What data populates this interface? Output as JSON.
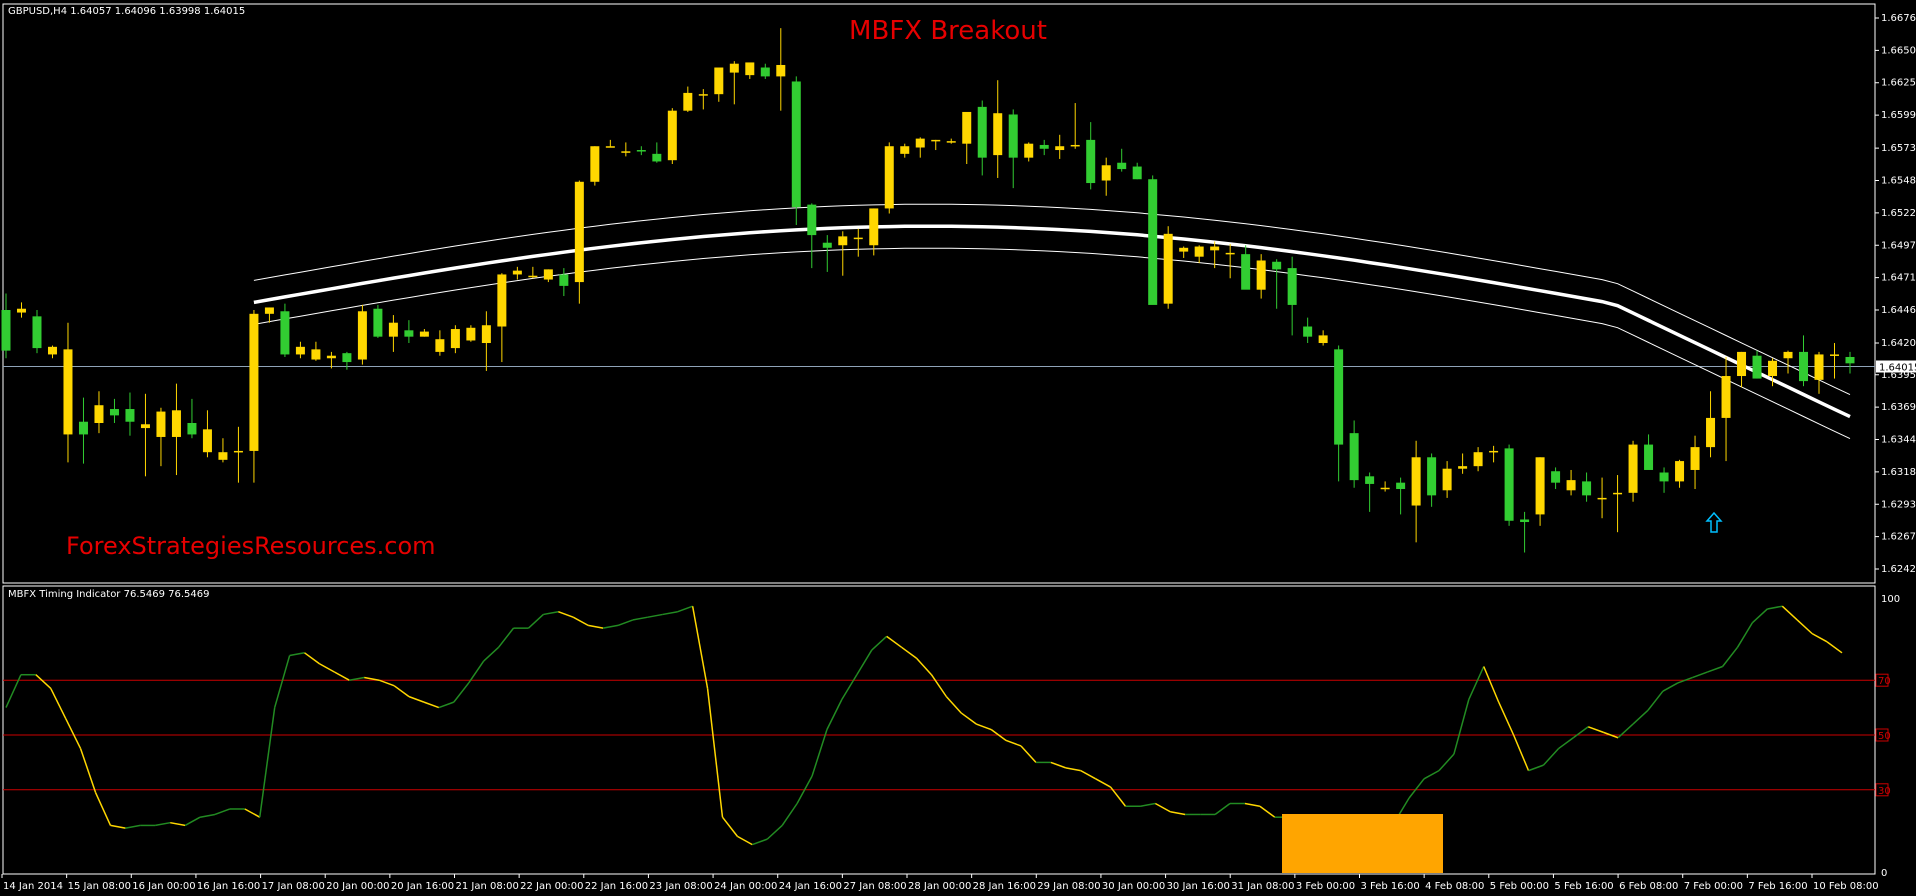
{
  "chart": {
    "header": "GBPUSD,H4  1.64057 1.64096 1.63998 1.64015",
    "title": "MBFX Breakout",
    "watermark": "ForexStrategiesResources.com",
    "indicator_header": "MBFX Timing Indicator 76.5469 76.5469",
    "current_price_label": "1.64015",
    "colors": {
      "background": "#000000",
      "bull_candle": "#32cd32",
      "bear_candle": "#ffd700",
      "envelope": "#ffffff",
      "indicator_up": "#228b22",
      "indicator_down": "#ffd700",
      "level_lines": "#cc0000",
      "signal_box": "#ffa500",
      "arrow": "#00bfff",
      "title": "#e60000",
      "watermark": "#e60000"
    }
  },
  "chart_data": [
    {
      "type": "candlestick",
      "symbol": "GBPUSD",
      "timeframe": "H4",
      "y_ticks": [
        "1.66760",
        "1.66505",
        "1.66250",
        "1.65995",
        "1.65735",
        "1.65480",
        "1.65225",
        "1.64970",
        "1.64715",
        "1.64460",
        "1.64200",
        "1.63950",
        "1.63695",
        "1.63440",
        "1.63185",
        "1.62930",
        "1.62675",
        "1.62420"
      ],
      "ylim": [
        1.6242,
        1.6676
      ],
      "x_ticks": [
        "14 Jan 2014",
        "15 Jan 08:00",
        "16 Jan 00:00",
        "16 Jan 16:00",
        "17 Jan 08:00",
        "20 Jan 00:00",
        "20 Jan 16:00",
        "21 Jan 08:00",
        "22 Jan 00:00",
        "22 Jan 16:00",
        "23 Jan 08:00",
        "24 Jan 00:00",
        "24 Jan 16:00",
        "27 Jan 08:00",
        "28 Jan 00:00",
        "28 Jan 16:00",
        "29 Jan 08:00",
        "30 Jan 00:00",
        "30 Jan 16:00",
        "31 Jan 08:00",
        "3 Feb 00:00",
        "3 Feb 16:00",
        "4 Feb 08:00",
        "5 Feb 00:00",
        "5 Feb 16:00",
        "6 Feb 08:00",
        "7 Feb 00:00",
        "7 Feb 16:00",
        "10 Feb 08:00"
      ],
      "current_price": 1.64015,
      "ohlc": [
        [
          1.6446,
          1.6459,
          1.6408,
          1.6414
        ],
        [
          1.6444,
          1.6452,
          1.644,
          1.6447
        ],
        [
          1.6441,
          1.6446,
          1.6412,
          1.6416
        ],
        [
          1.6411,
          1.6418,
          1.6408,
          1.6417
        ],
        [
          1.6348,
          1.6436,
          1.6326,
          1.6415
        ],
        [
          1.6358,
          1.6377,
          1.6325,
          1.6348
        ],
        [
          1.6357,
          1.6382,
          1.6349,
          1.6371
        ],
        [
          1.6368,
          1.6376,
          1.6357,
          1.6363
        ],
        [
          1.6368,
          1.6381,
          1.6347,
          1.6358
        ],
        [
          1.6353,
          1.638,
          1.6315,
          1.6356
        ],
        [
          1.6346,
          1.6369,
          1.6323,
          1.6366
        ],
        [
          1.6346,
          1.6388,
          1.6316,
          1.6367
        ],
        [
          1.6357,
          1.6376,
          1.6345,
          1.6348
        ],
        [
          1.6334,
          1.6367,
          1.633,
          1.6352
        ],
        [
          1.6328,
          1.6345,
          1.6326,
          1.6334
        ],
        [
          1.6334,
          1.6354,
          1.631,
          1.6335
        ],
        [
          1.6335,
          1.6446,
          1.631,
          1.6443
        ],
        [
          1.6443,
          1.6448,
          1.6436,
          1.6448
        ],
        [
          1.6445,
          1.6451,
          1.6409,
          1.6411
        ],
        [
          1.6411,
          1.6421,
          1.6408,
          1.6417
        ],
        [
          1.6407,
          1.6421,
          1.6406,
          1.6415
        ],
        [
          1.6408,
          1.6413,
          1.64,
          1.641
        ],
        [
          1.6412,
          1.6413,
          1.6399,
          1.6405
        ],
        [
          1.6407,
          1.645,
          1.6403,
          1.6445
        ],
        [
          1.6447,
          1.645,
          1.6424,
          1.6425
        ],
        [
          1.6425,
          1.6442,
          1.6413,
          1.6436
        ],
        [
          1.643,
          1.6438,
          1.642,
          1.6425
        ],
        [
          1.6425,
          1.6431,
          1.6425,
          1.6429
        ],
        [
          1.6413,
          1.643,
          1.641,
          1.6423
        ],
        [
          1.6416,
          1.6434,
          1.6412,
          1.6431
        ],
        [
          1.6422,
          1.6434,
          1.6421,
          1.6432
        ],
        [
          1.642,
          1.6445,
          1.6398,
          1.6434
        ],
        [
          1.6433,
          1.6475,
          1.6405,
          1.6474
        ],
        [
          1.6474,
          1.648,
          1.647,
          1.6477
        ],
        [
          1.6473,
          1.648,
          1.6471,
          1.6473
        ],
        [
          1.647,
          1.6478,
          1.6468,
          1.6478
        ],
        [
          1.6474,
          1.6479,
          1.6457,
          1.6465
        ],
        [
          1.6468,
          1.6548,
          1.6451,
          1.6547
        ],
        [
          1.6547,
          1.6575,
          1.6544,
          1.6575
        ],
        [
          1.6575,
          1.658,
          1.6574,
          1.6575
        ],
        [
          1.657,
          1.6578,
          1.6567,
          1.6571
        ],
        [
          1.6572,
          1.6575,
          1.6568,
          1.6571
        ],
        [
          1.6569,
          1.6578,
          1.6562,
          1.6563
        ],
        [
          1.6564,
          1.6605,
          1.6561,
          1.6603
        ],
        [
          1.6603,
          1.6622,
          1.6602,
          1.6617
        ],
        [
          1.6616,
          1.662,
          1.6604,
          1.6616
        ],
        [
          1.6616,
          1.6634,
          1.661,
          1.6637
        ],
        [
          1.6633,
          1.6642,
          1.6608,
          1.664
        ],
        [
          1.6631,
          1.664,
          1.6628,
          1.6641
        ],
        [
          1.6637,
          1.664,
          1.6628,
          1.663
        ],
        [
          1.663,
          1.6668,
          1.6603,
          1.6639
        ],
        [
          1.6626,
          1.663,
          1.6513,
          1.6527
        ],
        [
          1.6529,
          1.653,
          1.6479,
          1.6505
        ],
        [
          1.6499,
          1.6505,
          1.6476,
          1.6495
        ],
        [
          1.6497,
          1.6508,
          1.6473,
          1.6504
        ],
        [
          1.6502,
          1.651,
          1.6488,
          1.6503
        ],
        [
          1.6497,
          1.6526,
          1.6489,
          1.6526
        ],
        [
          1.6526,
          1.6578,
          1.6522,
          1.6575
        ],
        [
          1.6569,
          1.6577,
          1.6566,
          1.6575
        ],
        [
          1.6574,
          1.6582,
          1.6566,
          1.6581
        ],
        [
          1.6579,
          1.658,
          1.6572,
          1.658
        ],
        [
          1.6579,
          1.6581,
          1.6577,
          1.6579
        ],
        [
          1.6577,
          1.66,
          1.6561,
          1.6602
        ],
        [
          1.6606,
          1.6611,
          1.6552,
          1.6566
        ],
        [
          1.6568,
          1.6627,
          1.655,
          1.6601
        ],
        [
          1.66,
          1.6604,
          1.6542,
          1.6566
        ],
        [
          1.6566,
          1.6578,
          1.6563,
          1.6577
        ],
        [
          1.6576,
          1.658,
          1.6568,
          1.6573
        ],
        [
          1.6572,
          1.6584,
          1.6565,
          1.6575
        ],
        [
          1.6576,
          1.6609,
          1.6573,
          1.6576
        ],
        [
          1.658,
          1.6594,
          1.6541,
          1.6546
        ],
        [
          1.6548,
          1.6566,
          1.6536,
          1.656
        ],
        [
          1.6562,
          1.6573,
          1.6555,
          1.6557
        ],
        [
          1.6559,
          1.6562,
          1.6549,
          1.6549
        ],
        [
          1.6549,
          1.6552,
          1.6452,
          1.645
        ],
        [
          1.6451,
          1.6512,
          1.6447,
          1.6506
        ],
        [
          1.6492,
          1.6496,
          1.6487,
          1.6495
        ],
        [
          1.6488,
          1.6497,
          1.6483,
          1.6496
        ],
        [
          1.6493,
          1.65,
          1.6479,
          1.6496
        ],
        [
          1.6491,
          1.6498,
          1.6471,
          1.6491
        ],
        [
          1.649,
          1.6497,
          1.6469,
          1.6462
        ],
        [
          1.6462,
          1.649,
          1.6455,
          1.6485
        ],
        [
          1.6484,
          1.6486,
          1.6447,
          1.6478
        ],
        [
          1.6479,
          1.6488,
          1.6426,
          1.645
        ],
        [
          1.6433,
          1.644,
          1.642,
          1.6425
        ],
        [
          1.642,
          1.643,
          1.6418,
          1.6426
        ],
        [
          1.6415,
          1.6418,
          1.6311,
          1.634
        ],
        [
          1.6349,
          1.6359,
          1.6306,
          1.6312
        ],
        [
          1.6315,
          1.6318,
          1.6287,
          1.6309
        ],
        [
          1.6306,
          1.6311,
          1.6303,
          1.6306
        ],
        [
          1.631,
          1.6314,
          1.6285,
          1.6305
        ],
        [
          1.6292,
          1.6343,
          1.6263,
          1.633
        ],
        [
          1.633,
          1.6333,
          1.6291,
          1.63
        ],
        [
          1.6304,
          1.6327,
          1.6298,
          1.6321
        ],
        [
          1.6321,
          1.6333,
          1.6317,
          1.6323
        ],
        [
          1.6323,
          1.6338,
          1.6319,
          1.6334
        ],
        [
          1.6334,
          1.6339,
          1.6326,
          1.6335
        ],
        [
          1.6337,
          1.634,
          1.6276,
          1.628
        ],
        [
          1.6281,
          1.6287,
          1.6255,
          1.6279
        ],
        [
          1.6285,
          1.633,
          1.6276,
          1.633
        ],
        [
          1.6319,
          1.6322,
          1.6305,
          1.631
        ],
        [
          1.6304,
          1.632,
          1.63,
          1.6312
        ],
        [
          1.6311,
          1.6318,
          1.6295,
          1.63
        ],
        [
          1.6298,
          1.6314,
          1.6282,
          1.6298
        ],
        [
          1.6301,
          1.6316,
          1.6271,
          1.6302
        ],
        [
          1.6302,
          1.6343,
          1.6295,
          1.634
        ],
        [
          1.634,
          1.6348,
          1.6322,
          1.632
        ],
        [
          1.6318,
          1.6322,
          1.6302,
          1.6311
        ],
        [
          1.6311,
          1.6328,
          1.6306,
          1.6327
        ],
        [
          1.632,
          1.6347,
          1.6305,
          1.6338
        ],
        [
          1.6338,
          1.6382,
          1.633,
          1.6361
        ],
        [
          1.6361,
          1.6409,
          1.6327,
          1.6394
        ],
        [
          1.6394,
          1.6413,
          1.6385,
          1.6413
        ],
        [
          1.641,
          1.6414,
          1.6392,
          1.6392
        ],
        [
          1.6394,
          1.6408,
          1.6386,
          1.6406
        ],
        [
          1.6408,
          1.6414,
          1.6396,
          1.6413
        ],
        [
          1.6413,
          1.6426,
          1.6386,
          1.639
        ],
        [
          1.6391,
          1.6413,
          1.638,
          1.6411
        ],
        [
          1.6411,
          1.642,
          1.6392,
          1.6411
        ],
        [
          1.6409,
          1.6413,
          1.6396,
          1.6404
        ]
      ]
    },
    {
      "type": "line",
      "name": "MBFX Timing Indicator",
      "ylim": [
        0,
        100
      ],
      "y_ticks": [
        "100",
        "70",
        "50",
        "30",
        "0"
      ],
      "levels": [
        70,
        50,
        30
      ],
      "values": [
        60,
        72,
        72,
        67,
        56,
        45,
        29,
        17,
        16,
        17,
        17,
        18,
        17,
        20,
        21,
        23,
        23,
        20,
        60,
        79,
        80,
        76,
        73,
        70,
        71,
        70,
        68,
        64,
        62,
        60,
        62,
        69,
        77,
        82,
        89,
        89,
        94,
        95,
        93,
        90,
        89,
        90,
        92,
        93,
        94,
        95,
        97,
        67,
        20,
        13,
        10,
        12,
        17,
        25,
        35,
        52,
        63,
        72,
        81,
        86,
        82,
        78,
        72,
        64,
        58,
        54,
        52,
        48,
        46,
        40,
        40,
        38,
        37,
        34,
        31,
        24,
        24,
        25,
        22,
        21,
        21,
        21,
        25,
        25,
        24,
        20,
        20,
        10,
        3,
        1,
        2,
        5,
        10,
        18,
        27,
        34,
        37,
        43,
        63,
        75,
        62,
        50,
        37,
        39,
        45,
        49,
        53,
        51,
        49,
        54,
        59,
        66,
        69,
        71,
        73,
        75,
        82,
        91,
        96,
        97,
        92,
        87,
        84,
        80
      ]
    }
  ]
}
